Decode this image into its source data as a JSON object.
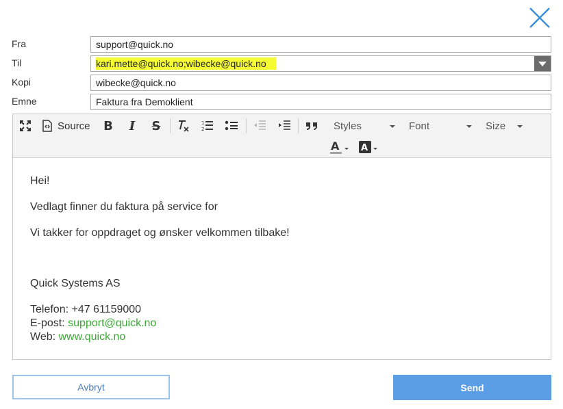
{
  "header": {
    "close_icon": "close-icon"
  },
  "form": {
    "from_label": "Fra",
    "from_value": "support@quick.no",
    "to_label": "Til",
    "to_value": "kari.mette@quick.no;wibecke@quick.no",
    "cc_label": "Kopi",
    "cc_value": "wibecke@quick.no",
    "subject_label": "Emne",
    "subject_value": "Faktura fra Demoklient"
  },
  "toolbar": {
    "source_label": "Source",
    "styles_label": "Styles",
    "font_label": "Font",
    "size_label": "Size",
    "icons": [
      "maximize-icon",
      "source-icon",
      "bold-icon",
      "italic-icon",
      "strikethrough-icon",
      "remove-format-icon",
      "numbered-list-icon",
      "bulleted-list-icon",
      "outdent-icon",
      "indent-icon",
      "blockquote-icon",
      "text-color-icon",
      "background-color-icon"
    ]
  },
  "body": {
    "greeting": "Hei!",
    "line1": "Vedlagt finner du faktura på service for",
    "line2": "Vi takker for oppdraget og ønsker velkommen tilbake!",
    "company": "Quick Systems AS",
    "phone": "Telefon: +47 61159000",
    "email_prefix": "E-post: ",
    "email_link": "support@quick.no",
    "web_prefix": "Web: ",
    "web_link": "www.quick.no"
  },
  "actions": {
    "cancel_label": "Avbryt",
    "send_label": "Send"
  },
  "colors": {
    "highlight": "#f6fc33",
    "link": "#3aa935",
    "send_button": "#5b9ee6",
    "close_icon": "#3d8ed8"
  }
}
